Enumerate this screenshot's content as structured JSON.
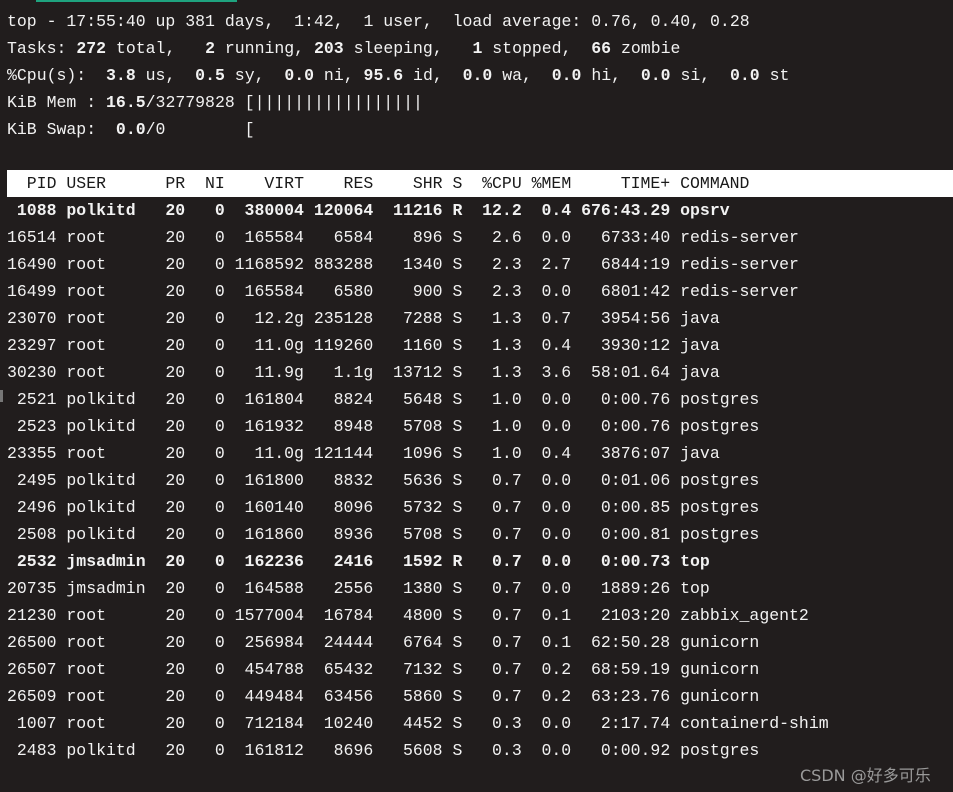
{
  "colors": {
    "background": "#211d1d",
    "text": "#f2f2f2",
    "header_bg": "#ffffff",
    "tab_accent": "#1fa37f"
  },
  "summary": {
    "line1": "top - 17:55:40 up 381 days,  1:42,  1 user,  load average: 0.76, 0.40, 0.28",
    "tasks": {
      "label": "Tasks: ",
      "total": "272",
      "total_l": " total,   ",
      "running": "2",
      "running_l": " running, ",
      "sleeping": "203",
      "sleeping_l": " sleeping,   ",
      "stopped": "1",
      "stopped_l": " stopped,  ",
      "zombie": "66",
      "zombie_l": " zombie"
    },
    "cpu": {
      "label": "%Cpu(s):  ",
      "us": "3.8",
      "us_l": " us,  ",
      "sy": "0.5",
      "sy_l": " sy,  ",
      "ni": "0.0",
      "ni_l": " ni, ",
      "id": "95.6",
      "id_l": " id,  ",
      "wa": "0.0",
      "wa_l": " wa,  ",
      "hi": "0.0",
      "hi_l": " hi,  ",
      "si": "0.0",
      "si_l": " si,  ",
      "st": "0.0",
      "st_l": " st"
    },
    "mem": {
      "label": "KiB Mem : ",
      "used": "16.5",
      "rest": "/32779828 ",
      "bar": "[|||||||||||||||||"
    },
    "swap": {
      "label": "KiB Swap:  ",
      "used": "0.0",
      "rest": "/0        ",
      "bar": "["
    }
  },
  "columns": [
    "PID",
    "USER",
    "PR",
    "NI",
    "VIRT",
    "RES",
    "SHR",
    "S",
    "%CPU",
    "%MEM",
    "TIME+",
    "COMMAND"
  ],
  "processes": [
    [
      "1088",
      "polkitd",
      "20",
      "0",
      "380004",
      "120064",
      "11216",
      "R",
      "12.2",
      "0.4",
      "676:43.29",
      "opsrv"
    ],
    [
      "16514",
      "root",
      "20",
      "0",
      "165584",
      "6584",
      "896",
      "S",
      "2.6",
      "0.0",
      "6733:40",
      "redis-server"
    ],
    [
      "16490",
      "root",
      "20",
      "0",
      "1168592",
      "883288",
      "1340",
      "S",
      "2.3",
      "2.7",
      "6844:19",
      "redis-server"
    ],
    [
      "16499",
      "root",
      "20",
      "0",
      "165584",
      "6580",
      "900",
      "S",
      "2.3",
      "0.0",
      "6801:42",
      "redis-server"
    ],
    [
      "23070",
      "root",
      "20",
      "0",
      "12.2g",
      "235128",
      "7288",
      "S",
      "1.3",
      "0.7",
      "3954:56",
      "java"
    ],
    [
      "23297",
      "root",
      "20",
      "0",
      "11.0g",
      "119260",
      "1160",
      "S",
      "1.3",
      "0.4",
      "3930:12",
      "java"
    ],
    [
      "30230",
      "root",
      "20",
      "0",
      "11.9g",
      "1.1g",
      "13712",
      "S",
      "1.3",
      "3.6",
      "58:01.64",
      "java"
    ],
    [
      "2521",
      "polkitd",
      "20",
      "0",
      "161804",
      "8824",
      "5648",
      "S",
      "1.0",
      "0.0",
      "0:00.76",
      "postgres"
    ],
    [
      "2523",
      "polkitd",
      "20",
      "0",
      "161932",
      "8948",
      "5708",
      "S",
      "1.0",
      "0.0",
      "0:00.76",
      "postgres"
    ],
    [
      "23355",
      "root",
      "20",
      "0",
      "11.0g",
      "121144",
      "1096",
      "S",
      "1.0",
      "0.4",
      "3876:07",
      "java"
    ],
    [
      "2495",
      "polkitd",
      "20",
      "0",
      "161800",
      "8832",
      "5636",
      "S",
      "0.7",
      "0.0",
      "0:01.06",
      "postgres"
    ],
    [
      "2496",
      "polkitd",
      "20",
      "0",
      "160140",
      "8096",
      "5732",
      "S",
      "0.7",
      "0.0",
      "0:00.85",
      "postgres"
    ],
    [
      "2508",
      "polkitd",
      "20",
      "0",
      "161860",
      "8936",
      "5708",
      "S",
      "0.7",
      "0.0",
      "0:00.81",
      "postgres"
    ],
    [
      "2532",
      "jmsadmin",
      "20",
      "0",
      "162236",
      "2416",
      "1592",
      "R",
      "0.7",
      "0.0",
      "0:00.73",
      "top"
    ],
    [
      "20735",
      "jmsadmin",
      "20",
      "0",
      "164588",
      "2556",
      "1380",
      "S",
      "0.7",
      "0.0",
      "1889:26",
      "top"
    ],
    [
      "21230",
      "root",
      "20",
      "0",
      "1577004",
      "16784",
      "4800",
      "S",
      "0.7",
      "0.1",
      "2103:20",
      "zabbix_agent2"
    ],
    [
      "26500",
      "root",
      "20",
      "0",
      "256984",
      "24444",
      "6764",
      "S",
      "0.7",
      "0.1",
      "62:50.28",
      "gunicorn"
    ],
    [
      "26507",
      "root",
      "20",
      "0",
      "454788",
      "65432",
      "7132",
      "S",
      "0.7",
      "0.2",
      "68:59.19",
      "gunicorn"
    ],
    [
      "26509",
      "root",
      "20",
      "0",
      "449484",
      "63456",
      "5860",
      "S",
      "0.7",
      "0.2",
      "63:23.76",
      "gunicorn"
    ],
    [
      "1007",
      "root",
      "20",
      "0",
      "712184",
      "10240",
      "4452",
      "S",
      "0.3",
      "0.0",
      "2:17.74",
      "containerd-shim"
    ],
    [
      "2483",
      "polkitd",
      "20",
      "0",
      "161812",
      "8696",
      "5608",
      "S",
      "0.3",
      "0.0",
      "0:00.92",
      "postgres"
    ]
  ],
  "watermark": "CSDN @好多可乐"
}
